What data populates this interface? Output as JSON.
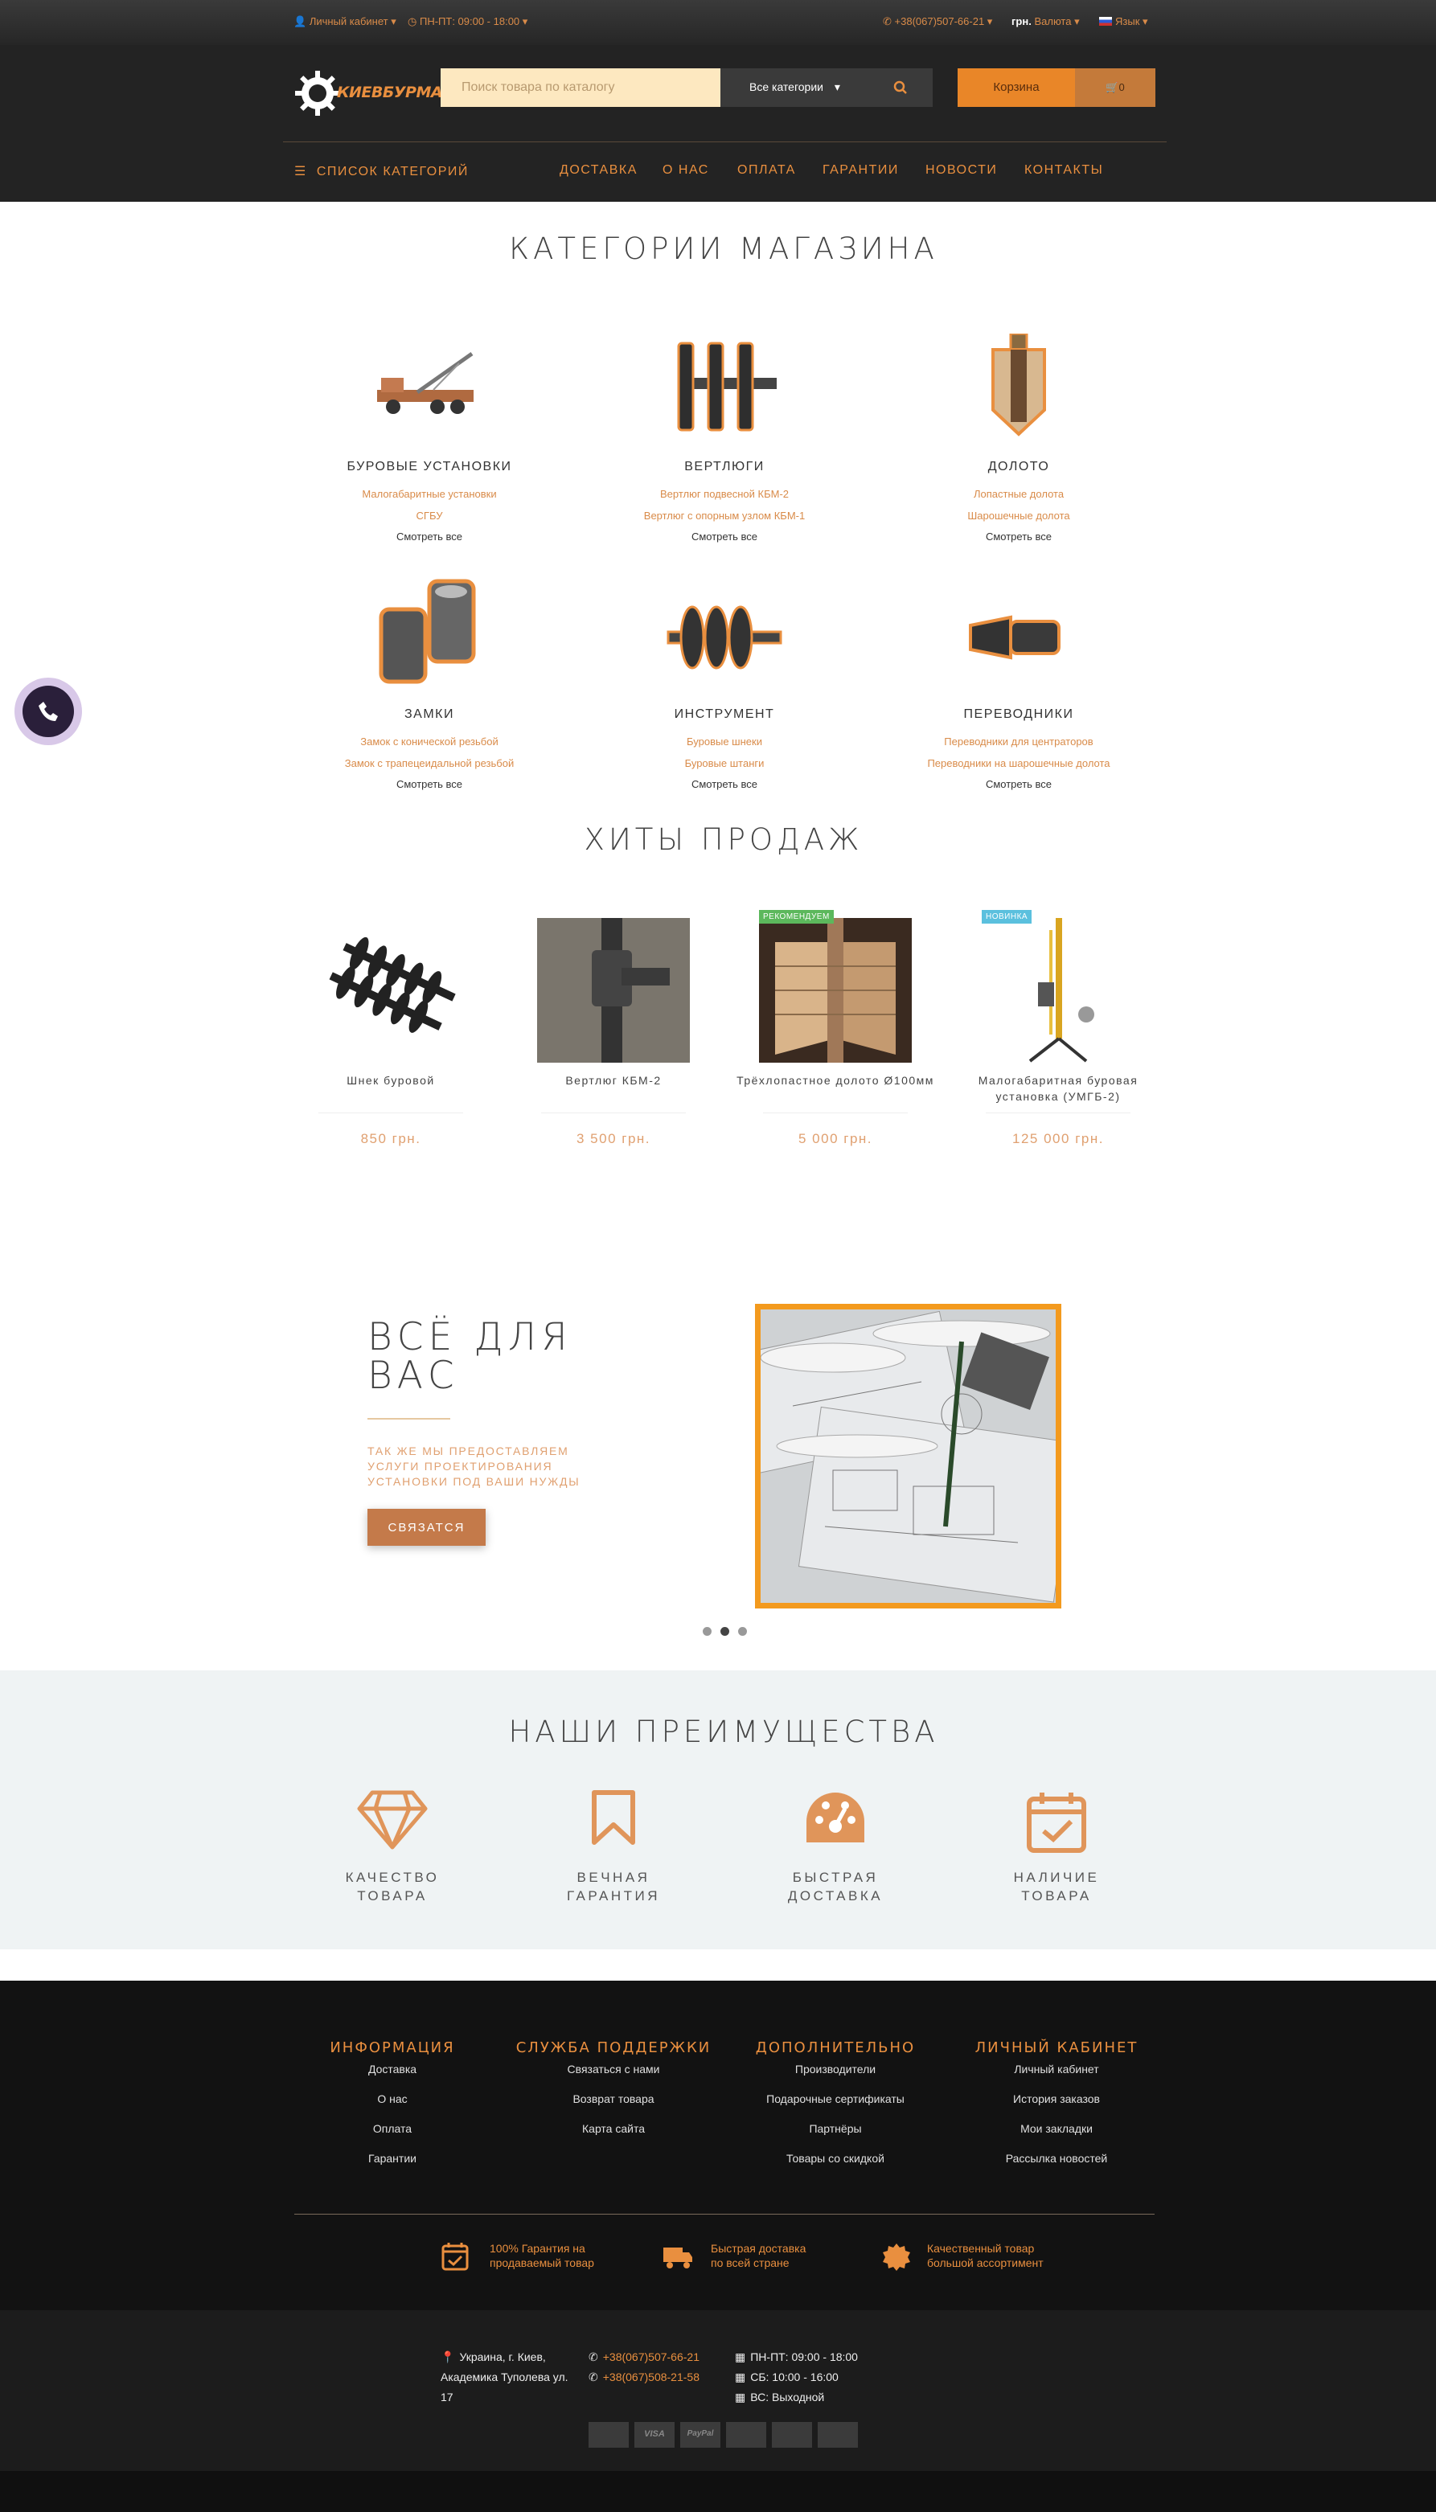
{
  "topbar": {
    "account": "Личный кабинет",
    "hours": "ПН-ПТ: 09:00 - 18:00",
    "phone": "+38(067)507-66-21",
    "currency_symbol": "грн.",
    "currency_label": "Валюта",
    "language": "Язык"
  },
  "header": {
    "logo_text": "КИЕВБУРМАШ",
    "search_placeholder": "Поиск товара по каталогу",
    "search_category": "Все категории",
    "cart_label": "Корзина",
    "cart_count": "0",
    "category_list": "СПИСОК КАТЕГОРИЙ",
    "nav": [
      "ДОСТАВКА",
      "О НАС",
      "ОПЛАТА",
      "ГАРАНТИИ",
      "НОВОСТИ",
      "КОНТАКТЫ"
    ]
  },
  "categories": {
    "title": "КАТЕГОРИИ МАГАЗИНА",
    "see_all": "Смотреть все",
    "items": [
      {
        "name": "БУРОВЫЕ УСТАНОВКИ",
        "sub1": "Малогабаритные установки",
        "sub2": "СГБУ",
        "icon": "drill-rig"
      },
      {
        "name": "ВЕРТЛЮГИ",
        "sub1": "Вертлюг подвесной КБМ-2",
        "sub2": "Вертлюг с опорным узлом КБМ-1",
        "icon": "swivel"
      },
      {
        "name": "ДОЛОТО",
        "sub1": "Лопастные долота",
        "sub2": "Шарошечные долота",
        "icon": "drill-bit"
      },
      {
        "name": "ЗАМКИ",
        "sub1": "Замок с конической резьбой",
        "sub2": "Замок с трапецеидальной резьбой",
        "icon": "tool-joint"
      },
      {
        "name": "ИНСТРУМЕНТ",
        "sub1": "Буровые шнеки",
        "sub2": "Буровые штанги",
        "icon": "auger"
      },
      {
        "name": "ПЕРЕВОДНИКИ",
        "sub1": "Переводники для центраторов",
        "sub2": "Переводники на шарошечные долота",
        "icon": "adapter"
      }
    ]
  },
  "bestsellers": {
    "title": "ХИТЫ ПРОДАЖ",
    "items": [
      {
        "name": "Шнек буровой",
        "price": "850 грн.",
        "badge": ""
      },
      {
        "name": "Вертлюг КБМ-2",
        "price": "3 500 грн.",
        "badge": ""
      },
      {
        "name": "Трёхлопастное долото Ø100мм",
        "price": "5 000 грн.",
        "badge": "РЕКОМЕНДУЕМ",
        "badge_color": "#5cb85c"
      },
      {
        "name": "Малогабаритная буровая установка (УМГБ-2)",
        "price": "125 000 грн.",
        "badge": "НОВИНКА",
        "badge_color": "#5bc0de"
      }
    ]
  },
  "promo": {
    "title_line1": "ВСЁ ДЛЯ",
    "title_line2": "ВАС",
    "text": "ТАК ЖЕ МЫ ПРЕДОСТАВЛЯЕМ УСЛУГИ ПРОЕКТИРОВАНИЯ УСТАНОВКИ ПОД ВАШИ НУЖДЫ",
    "button": "СВЯЗАТСЯ",
    "slides": 3,
    "active_slide": 2
  },
  "advantages": {
    "title": "НАШИ ПРЕИМУЩЕСТВА",
    "items": [
      {
        "line1": "КАЧЕСТВО",
        "line2": "ТОВАРА",
        "icon": "diamond-icon"
      },
      {
        "line1": "ВЕЧНАЯ",
        "line2": "ГАРАНТИЯ",
        "icon": "bookmark-icon"
      },
      {
        "line1": "БЫСТРАЯ",
        "line2": "ДОСТАВКА",
        "icon": "palette-icon"
      },
      {
        "line1": "НАЛИЧИЕ",
        "line2": "ТОВАРА",
        "icon": "calendar-check-icon"
      }
    ]
  },
  "footer": {
    "columns": [
      {
        "title": "ИНФОРМАЦИЯ",
        "links": [
          "Доставка",
          "О нас",
          "Оплата",
          "Гарантии"
        ]
      },
      {
        "title": "СЛУЖБА ПОДДЕРЖКИ",
        "links": [
          "Связаться с нами",
          "Возврат товара",
          "Карта сайта"
        ]
      },
      {
        "title": "ДОПОЛНИТЕЛЬНО",
        "links": [
          "Производители",
          "Подарочные сертификаты",
          "Партнёры",
          "Товары со скидкой"
        ]
      },
      {
        "title": "ЛИЧНЫЙ КАБИНЕТ",
        "links": [
          "Личный кабинет",
          "История заказов",
          "Мои закладки",
          "Рассылка новостей"
        ]
      }
    ],
    "features": [
      {
        "line1": "100% Гарантия на",
        "line2": "продаваемый товар",
        "icon": "calendar-check-icon"
      },
      {
        "line1": "Быстрая доставка",
        "line2": "по всей стране",
        "icon": "truck-icon"
      },
      {
        "line1": "Качественный товар",
        "line2": "большой ассортимент",
        "icon": "badge-icon"
      }
    ],
    "address": [
      "Украина, г. Киев,",
      "Академика Туполева ул.",
      "17"
    ],
    "phones": [
      "+38(067)507-66-21",
      "+38(067)508-21-58"
    ],
    "schedule": [
      "ПН-ПТ: 09:00 - 18:00",
      "СБ: 10:00 - 16:00",
      "ВС: Выходной"
    ],
    "payments": [
      "",
      "VISA",
      "PayPal",
      "",
      "",
      ""
    ]
  },
  "colors": {
    "accent": "#e98f3f",
    "dark": "#232323",
    "advantages_bg": "#eff3f4"
  }
}
